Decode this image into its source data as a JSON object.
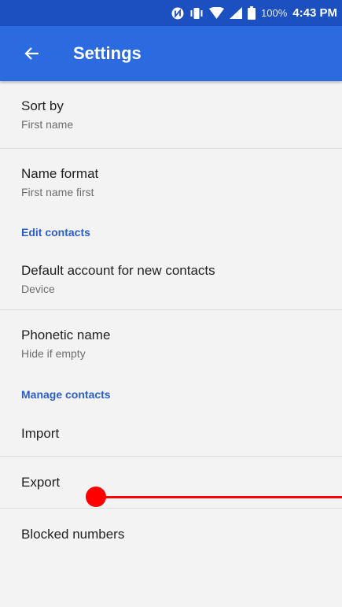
{
  "status_bar": {
    "battery_percent": "100%",
    "time": "4:43 PM",
    "icons": [
      "nfc-icon",
      "vibrate-icon",
      "wifi-icon",
      "cell-signal-icon",
      "battery-icon"
    ]
  },
  "toolbar": {
    "back_icon": "arrow-back-icon",
    "title": "Settings"
  },
  "settings": {
    "sort_by": {
      "label": "Sort by",
      "value": "First name"
    },
    "name_format": {
      "label": "Name format",
      "value": "First name first"
    },
    "edit_contacts_header": "Edit contacts",
    "default_account": {
      "label": "Default account for new contacts",
      "value": "Device"
    },
    "phonetic_name": {
      "label": "Phonetic name",
      "value": "Hide if empty"
    },
    "manage_contacts_header": "Manage contacts",
    "import": {
      "label": "Import"
    },
    "export": {
      "label": "Export"
    },
    "blocked_numbers": {
      "label": "Blocked numbers"
    }
  },
  "colors": {
    "status_bar": "#1c4fbf",
    "toolbar": "#2c6bdf",
    "section_header": "#2c5fc6",
    "gesture": "#ff0000"
  }
}
